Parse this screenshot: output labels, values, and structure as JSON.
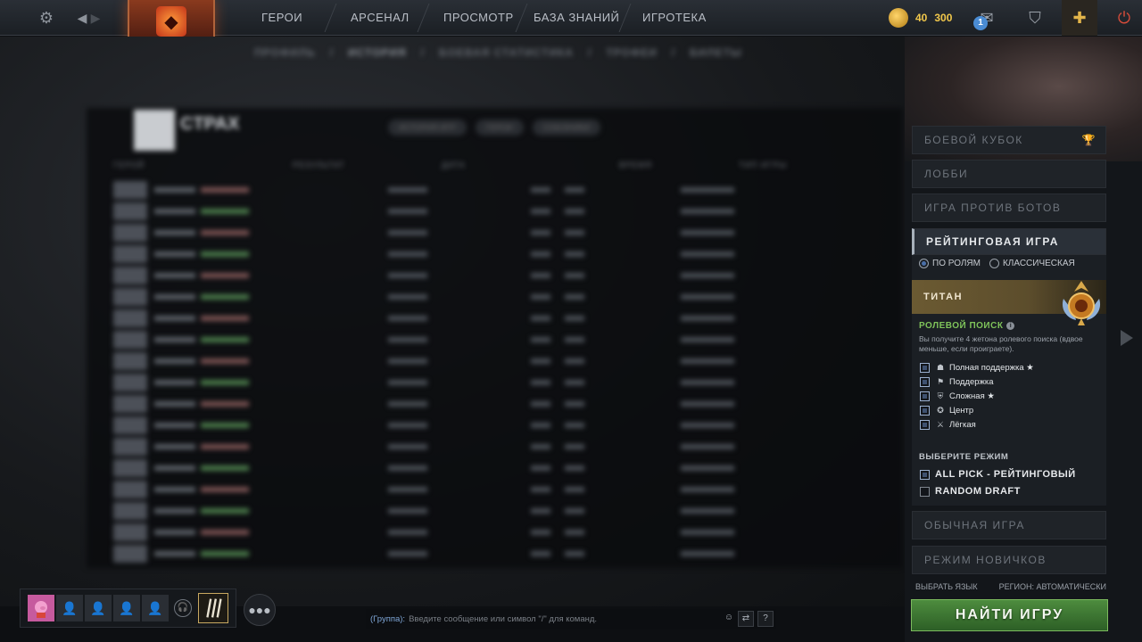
{
  "topbar": {
    "nav": [
      "ГЕРОИ",
      "АРСЕНАЛ",
      "ПРОСМОТР",
      "БАЗА ЗНАНИЙ",
      "ИГРОТЕКА"
    ],
    "currency_main": "40",
    "currency_second": "300",
    "message_count": "1"
  },
  "background": {
    "subnav": [
      "ПРОФИЛЬ",
      "/",
      "ИСТОРИЯ",
      "/",
      "БОЕВАЯ СТАТИСТИКА",
      "/",
      "ТРОФЕИ",
      "/",
      "БИЛЕТЫ"
    ],
    "profile_name": "CTPAX",
    "tabs": [
      "ИСТОРИЯ ИГР",
      "ГЕРОИ",
      "СОЮЗНИКИ"
    ],
    "columns": [
      "ГЕРОЙ",
      "РЕЗУЛЬТАТ",
      "ДАТА",
      "ВРЕМЯ",
      "ТИП ИГРЫ"
    ]
  },
  "right_panel": {
    "modes_top": [
      "БОЕВОЙ КУБОК",
      "ЛОББИ",
      "ИГРА ПРОТИВ БОТОВ"
    ],
    "ranked_label": "РЕЙТИНГОВАЯ ИГРА",
    "radio_roles": "ПО РОЛЯМ",
    "radio_classic": "КЛАССИЧЕСКАЯ",
    "rank_name": "ТИТАН",
    "role_search_title": "РОЛЕВОЙ ПОИСК",
    "role_search_desc": "Вы получите 4 жетона ролевого поиска (вдвое меньше, если проиграете).",
    "roles": [
      {
        "label": "Полная поддержка ★",
        "icon": "hard-support-icon",
        "glyph": "☗"
      },
      {
        "label": "Поддержка",
        "icon": "support-icon",
        "glyph": "⚑"
      },
      {
        "label": "Сложная ★",
        "icon": "offlane-icon",
        "glyph": "⛨"
      },
      {
        "label": "Центр",
        "icon": "mid-icon",
        "glyph": "✪"
      },
      {
        "label": "Лёгкая",
        "icon": "safelane-icon",
        "glyph": "⚔"
      }
    ],
    "select_mode_title": "ВЫБЕРИТЕ РЕЖИМ",
    "mode_options": [
      {
        "label": "ALL PICK - РЕЙТИНГОВЫЙ",
        "checked": true
      },
      {
        "label": "RANDOM DRAFT",
        "checked": false
      }
    ],
    "modes_bottom": [
      "ОБЫЧНАЯ ИГРА",
      "РЕЖИМ НОВИЧКОВ"
    ],
    "select_language": "ВЫБРАТЬ ЯЗЫК",
    "region": "РЕГИОН: АВТОМАТИЧЕСКИ",
    "find_game": "НАЙТИ ИГРУ"
  },
  "chat": {
    "channel": "(Группа):",
    "placeholder": "Введите сообщение или символ \"/\" для команд."
  },
  "colors": {
    "accent_green": "#4d8c3e",
    "rank_gold": "#6b5a32",
    "role_title_green": "#7fc35a"
  }
}
